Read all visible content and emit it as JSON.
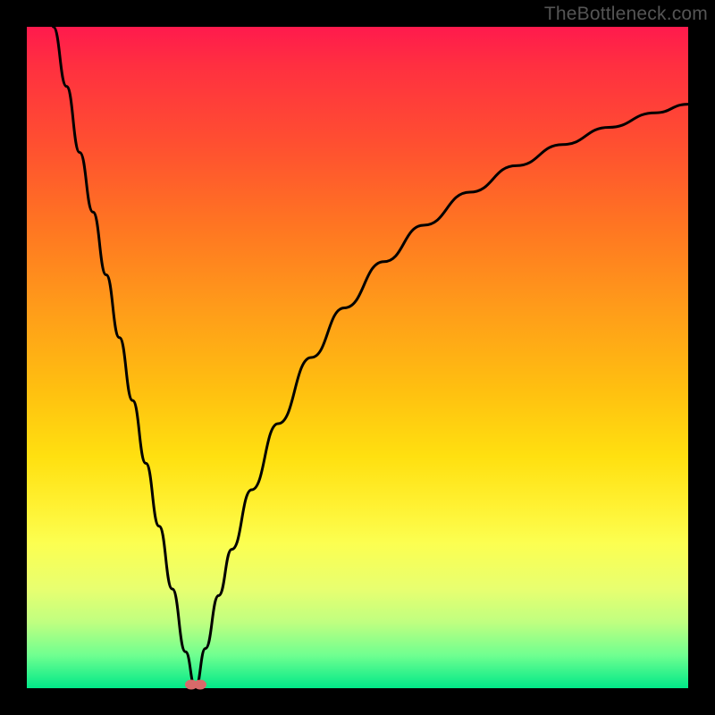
{
  "watermark": "TheBottleneck.com",
  "chart_data": {
    "type": "line",
    "title": "",
    "xlabel": "",
    "ylabel": "",
    "xlim": [
      0,
      100
    ],
    "ylim": [
      0,
      100
    ],
    "grid": false,
    "legend": false,
    "series": [
      {
        "name": "left-branch",
        "x": [
          4,
          6,
          8,
          10,
          12,
          14,
          16,
          18,
          20,
          22,
          24,
          25.5
        ],
        "y": [
          100,
          91,
          81,
          72,
          62.5,
          53,
          43.5,
          34,
          24.5,
          15,
          5.5,
          0
        ]
      },
      {
        "name": "right-branch",
        "x": [
          25.5,
          27,
          29,
          31,
          34,
          38,
          43,
          48,
          54,
          60,
          67,
          74,
          81,
          88,
          95,
          100
        ],
        "y": [
          0,
          6,
          14,
          21,
          30,
          40,
          50,
          57.5,
          64.5,
          70,
          75,
          79,
          82.2,
          84.8,
          87,
          88.3
        ]
      }
    ],
    "markers": [
      {
        "name": "min-point-1",
        "x": 24.8,
        "y": 0.5
      },
      {
        "name": "min-point-2",
        "x": 26.2,
        "y": 0.5
      }
    ],
    "background_gradient": {
      "top": "#ff1a4d",
      "mid": "#ffd020",
      "bottom": "#00e888"
    }
  }
}
